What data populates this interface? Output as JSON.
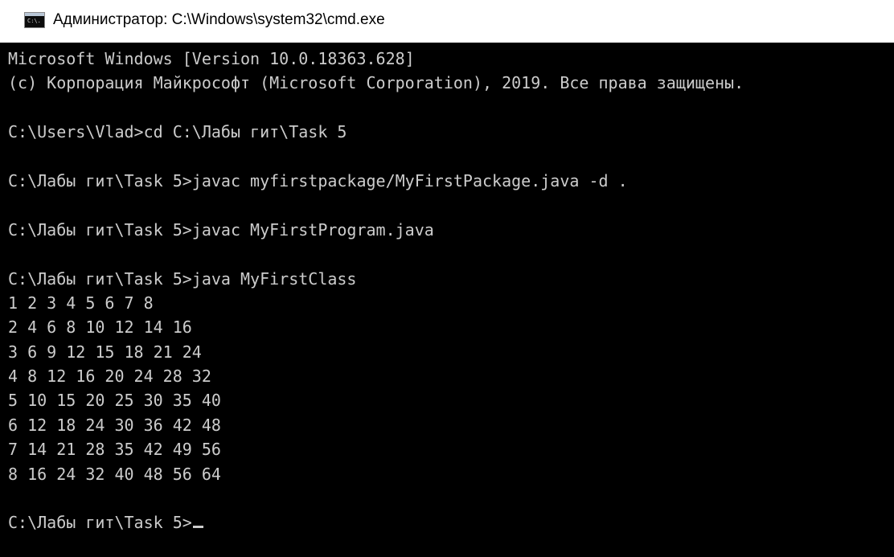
{
  "window": {
    "title": "Администратор: C:\\Windows\\system32\\cmd.exe",
    "icon": "cmd-icon",
    "icon_text": "C:\\."
  },
  "console": {
    "lines": [
      "Microsoft Windows [Version 10.0.18363.628]",
      "(c) Корпорация Майкрософт (Microsoft Corporation), 2019. Все права защищены.",
      "",
      "C:\\Users\\Vlad>cd C:\\Лабы гит\\Task 5",
      "",
      "C:\\Лабы гит\\Task 5>javac myfirstpackage/MyFirstPackage.java -d .",
      "",
      "C:\\Лабы гит\\Task 5>javac MyFirstProgram.java",
      "",
      "C:\\Лабы гит\\Task 5>java MyFirstClass",
      "1 2 3 4 5 6 7 8",
      "2 4 6 8 10 12 14 16",
      "3 6 9 12 15 18 21 24",
      "4 8 12 16 20 24 28 32",
      "5 10 15 20 25 30 35 40",
      "6 12 18 24 30 36 42 48",
      "7 14 21 28 35 42 49 56",
      "8 16 24 32 40 48 56 64",
      ""
    ],
    "prompt": "C:\\Лабы гит\\Task 5>"
  },
  "colors": {
    "background": "#000000",
    "text": "#cccccc",
    "titlebar": "#ffffff"
  }
}
